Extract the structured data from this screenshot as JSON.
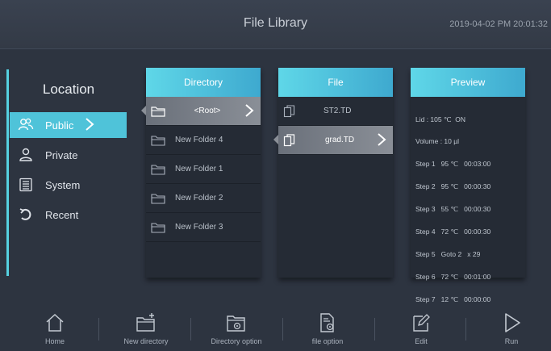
{
  "header": {
    "title": "File Library",
    "datetime": "2019-04-02 PM 20:01:32"
  },
  "location": {
    "title": "Location",
    "items": [
      {
        "label": "Public",
        "icon": "group-icon",
        "active": true
      },
      {
        "label": "Private",
        "icon": "user-icon",
        "active": false
      },
      {
        "label": "System",
        "icon": "list-icon",
        "active": false
      },
      {
        "label": "Recent",
        "icon": "undo-icon",
        "active": false
      }
    ]
  },
  "directory": {
    "title": "Directory",
    "items": [
      "<Root>",
      "New Folder 4",
      "New Folder 1",
      "New Folder 2",
      "New Folder 3"
    ],
    "selected": 0
  },
  "file": {
    "title": "File",
    "items": [
      "ST2.TD",
      "grad.TD"
    ],
    "selected": 1
  },
  "preview": {
    "title": "Preview",
    "lines": [
      "Lid : 105 ℃  ON",
      "Volume : 10 µl",
      "Step 1   95 ℃   00:03:00",
      "Step 2   95 ℃   00:00:30",
      "Step 3   55 ℃   00:00:30",
      "Step 4   72 ℃   00:00:30",
      "Step 5   Goto 2   x 29",
      "Step 6   72 ℃   00:01:00",
      "Step 7   12 ℃   00:00:00"
    ]
  },
  "toolbar": {
    "home": "Home",
    "new_directory": "New directory",
    "directory_option": "Directory option",
    "file_option": "file option",
    "edit": "Edit",
    "run": "Run"
  },
  "colors": {
    "accent": "#4fc3d9",
    "background": "#2d3440",
    "panel": "#252b35"
  }
}
